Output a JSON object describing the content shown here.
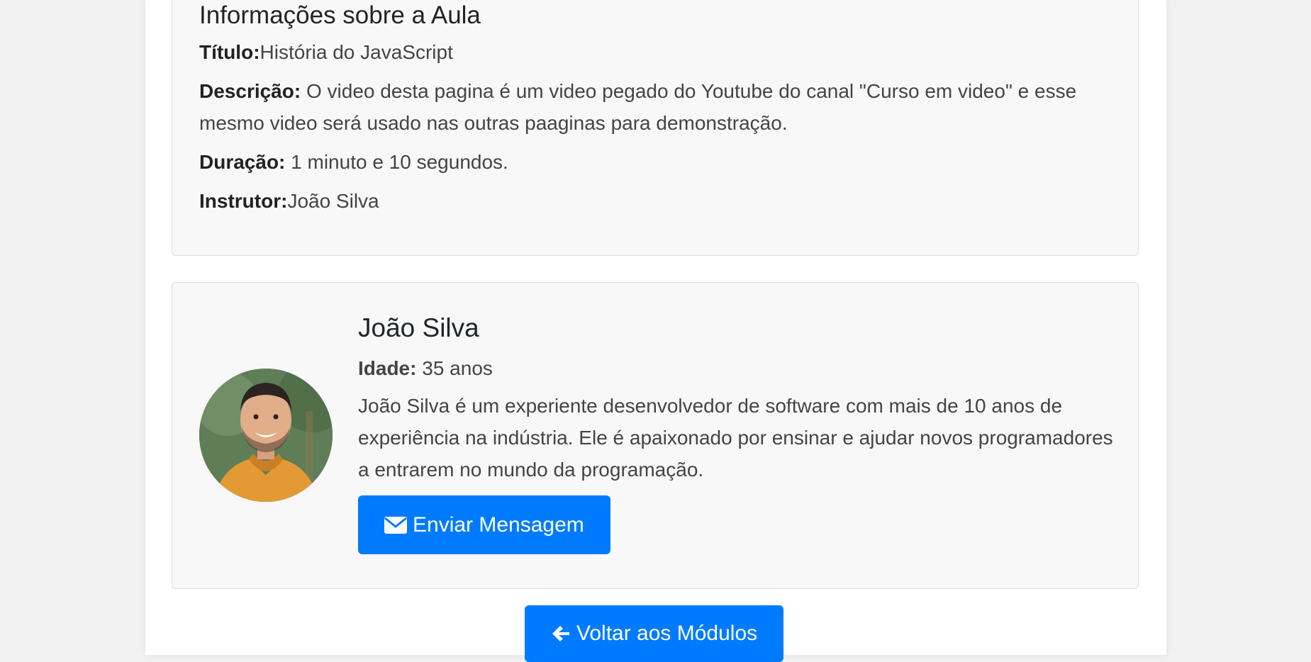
{
  "info": {
    "heading": "Informações sobre a Aula",
    "title_label": "Título:",
    "title_value": "História do JavaScript",
    "description_label": "Descrição:",
    "description_value": " O video desta pagina é um video pegado do Youtube do canal \"Curso em video\" e esse mesmo video será usado nas outras paaginas para demonstração.",
    "duration_label": "Duração:",
    "duration_value": " 1 minuto e 10 segundos.",
    "instructor_label": "Instrutor:",
    "instructor_value": "João Silva"
  },
  "instructor": {
    "name": "João Silva",
    "age_label": "Idade:",
    "age_value": " 35 anos",
    "bio": "João Silva é um experiente desenvolvedor de software com mais de 10 anos de experiência na indústria. Ele é apaixonado por ensinar e ajudar novos programadores a entrarem no mundo da programação.",
    "message_button": "Enviar Mensagem",
    "message_icon": "envelope-icon",
    "avatar_icon": "instructor-photo"
  },
  "footer": {
    "back_button": "Voltar aos Módulos",
    "back_icon": "arrow-left-icon"
  },
  "colors": {
    "primary": "#007bff",
    "card_background": "#f8f8f8",
    "page_background": "#f2f2f2"
  }
}
